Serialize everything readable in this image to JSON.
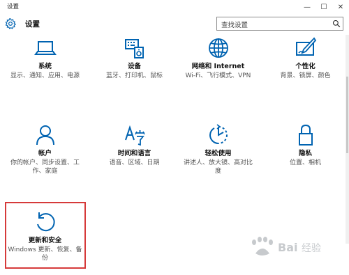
{
  "window": {
    "title": "设置",
    "minimize": "—",
    "maximize": "☐",
    "close": "✕"
  },
  "header": {
    "title": "设置",
    "search_placeholder": "查找设置"
  },
  "tiles": [
    {
      "icon": "laptop-icon",
      "label": "系统",
      "desc": "显示、通知、应用、电源"
    },
    {
      "icon": "keyboard-speaker-icon",
      "label": "设备",
      "desc": "蓝牙、打印机、鼠标"
    },
    {
      "icon": "globe-icon",
      "label": "网络和 Internet",
      "desc": "Wi-Fi、飞行模式、VPN"
    },
    {
      "icon": "paint-icon",
      "label": "个性化",
      "desc": "背景、锁屏、颜色"
    },
    {
      "icon": "person-icon",
      "label": "帐户",
      "desc": "你的帐户、同步设置、工作、家庭"
    },
    {
      "icon": "time-language-icon",
      "label": "时间和语言",
      "desc": "语音、区域、日期"
    },
    {
      "icon": "ease-of-access-icon",
      "label": "轻松使用",
      "desc": "讲述人、放大镜、高对比度"
    },
    {
      "icon": "lock-icon",
      "label": "隐私",
      "desc": "位置、相机"
    },
    {
      "icon": "update-icon",
      "label": "更新和安全",
      "desc": "Windows 更新、恢复、备份"
    }
  ],
  "colors": {
    "accent": "#0063b1",
    "highlight": "#d63a3a"
  }
}
